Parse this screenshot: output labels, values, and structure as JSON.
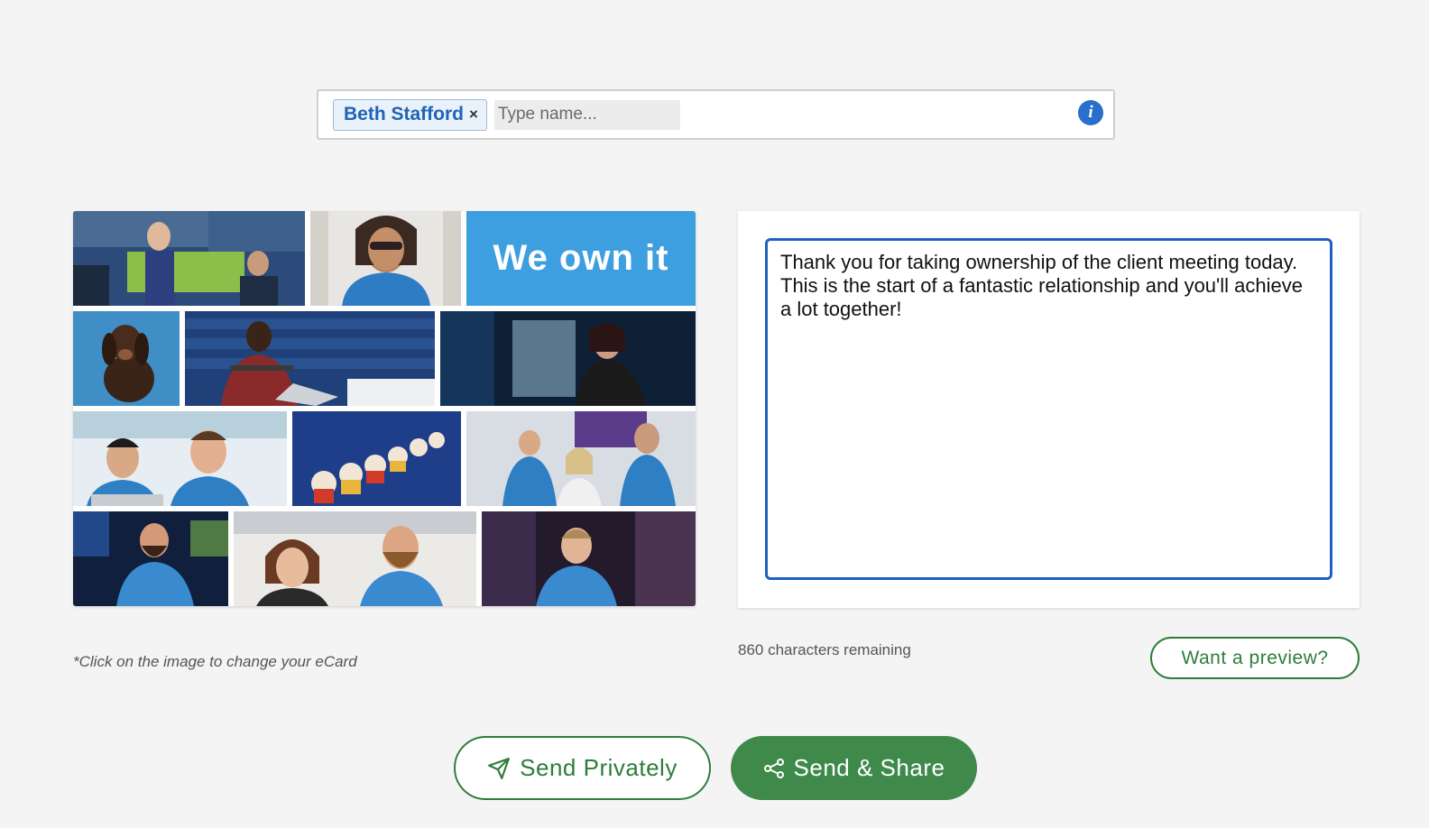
{
  "recipient": {
    "chip_name": "Beth Stafford",
    "chip_remove": "×",
    "placeholder": "Type name...",
    "info_icon": "i"
  },
  "ecard": {
    "brand_text": "We own it",
    "hint": "*Click on the image to change your eCard"
  },
  "message": {
    "text": "Thank you for taking ownership of the client meeting today. This is the start of a fantastic relationship and you'll achieve a lot together!",
    "characters_remaining": "860 characters remaining"
  },
  "actions": {
    "preview_label": "Want a preview?",
    "send_private_label": "Send Privately",
    "send_share_label": "Send & Share"
  },
  "colors": {
    "accent_green": "#3f8a4b",
    "focus_blue": "#2260c0",
    "brand_blue": "#3e9fe0"
  },
  "icons": {
    "send_private": "paper-plane-icon",
    "send_share": "share-nodes-icon",
    "info": "info-icon"
  }
}
